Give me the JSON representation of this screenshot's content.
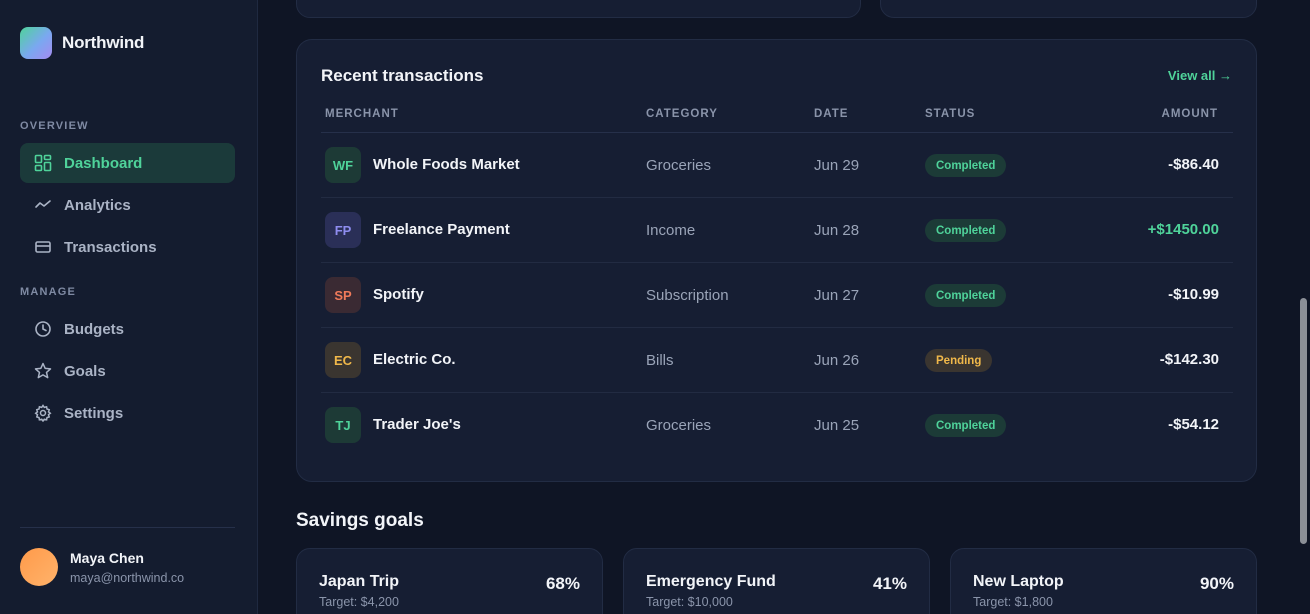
{
  "brand": {
    "name": "Northwind"
  },
  "sidebar": {
    "overview_label": "OVERVIEW",
    "manage_label": "MANAGE",
    "overview_items": [
      {
        "label": "Dashboard",
        "icon": "dashboard-icon",
        "active": true
      },
      {
        "label": "Analytics",
        "icon": "trend-icon"
      },
      {
        "label": "Transactions",
        "icon": "card-icon"
      }
    ],
    "manage_items": [
      {
        "label": "Budgets",
        "icon": "clock-icon"
      },
      {
        "label": "Goals",
        "icon": "star-icon"
      },
      {
        "label": "Settings",
        "icon": "gear-icon"
      }
    ]
  },
  "user": {
    "name": "Maya Chen",
    "email": "maya@northwind.co"
  },
  "transactions": {
    "title": "Recent transactions",
    "view_all": "View all →",
    "columns": [
      "MERCHANT",
      "CATEGORY",
      "DATE",
      "STATUS",
      "AMOUNT"
    ],
    "rows": [
      {
        "initials": "WF",
        "merchant": "Whole Foods Market",
        "category": "Groceries",
        "date": "Jun 29",
        "status": "Completed",
        "amount": "-$86.40"
      },
      {
        "initials": "FP",
        "merchant": "Freelance Payment",
        "category": "Income",
        "date": "Jun 28",
        "status": "Completed",
        "amount": "+$1450.00"
      },
      {
        "initials": "SP",
        "merchant": "Spotify",
        "category": "Subscription",
        "date": "Jun 27",
        "status": "Completed",
        "amount": "-$10.99"
      },
      {
        "initials": "EC",
        "merchant": "Electric Co.",
        "category": "Bills",
        "date": "Jun 26",
        "status": "Pending",
        "amount": "-$142.30"
      },
      {
        "initials": "TJ",
        "merchant": "Trader Joe's",
        "category": "Groceries",
        "date": "Jun 25",
        "status": "Completed",
        "amount": "-$54.12"
      }
    ]
  },
  "savings": {
    "title": "Savings goals",
    "goals": [
      {
        "name": "Japan Trip",
        "target": "Target: $4,200",
        "percent": "68%"
      },
      {
        "name": "Emergency Fund",
        "target": "Target: $10,000",
        "percent": "41%"
      },
      {
        "name": "New Laptop",
        "target": "Target: $1,800",
        "percent": "90%"
      }
    ]
  },
  "colors": {
    "accent": "#4fd39a",
    "positive": "#4fd39a",
    "pending": "#f0b84a",
    "background": "#0f1525",
    "card": "#161e33"
  }
}
